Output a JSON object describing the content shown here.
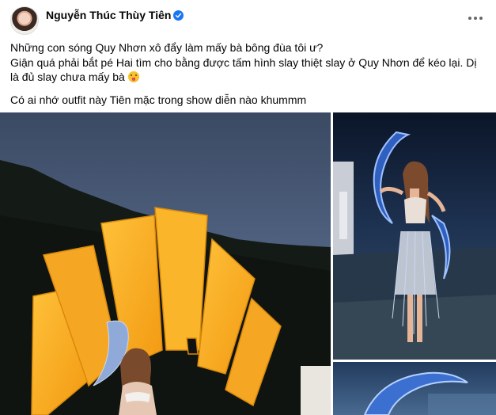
{
  "post": {
    "author": "Nguyễn Thúc Thùy Tiên",
    "verified_icon": "verified-badge-icon",
    "more_icon": "more-options-icon",
    "lines": [
      "Những con sóng Quy Nhơn xô đẩy làm mấy bà bông đùa tôi ư?",
      "Giận quá phải bắt pé Hai tìm cho bằng được tấm hình slay thiệt slay ở Quy Nhơn để kéo lại. Dị là đủ slay chưa mấy bà",
      "Có ai nhớ outfit này Tiên mặc trong show diễn nào khummm"
    ],
    "emoji_icon": "tongue-face-emoji-icon"
  },
  "colors": {
    "verified": "#1877f2",
    "text": "#050505"
  }
}
